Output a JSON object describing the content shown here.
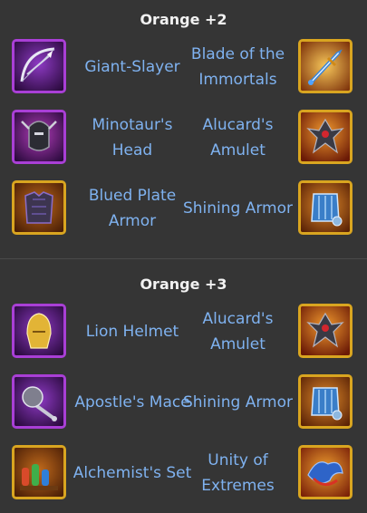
{
  "sections": [
    {
      "title": "Orange +2",
      "rows": [
        {
          "left": {
            "name": "Giant-Slayer",
            "icon": "bow-icon",
            "frame": "purple"
          },
          "right": {
            "name": "Blade of the Immortals",
            "icon": "glowing-sword-icon",
            "frame": "orange"
          }
        },
        {
          "left": {
            "name": "Minotaur's Head",
            "icon": "horned-helmet-icon",
            "frame": "purple"
          },
          "right": {
            "name": "Alucard's Amulet",
            "icon": "spiked-amulet-icon",
            "frame": "orange"
          }
        },
        {
          "left": {
            "name": "Blued Plate Armor",
            "icon": "plate-armor-icon",
            "frame": "orange"
          },
          "right": {
            "name": "Shining Armor",
            "icon": "blue-armor-icon",
            "frame": "orange"
          }
        }
      ]
    },
    {
      "title": "Orange +3",
      "rows": [
        {
          "left": {
            "name": "Lion Helmet",
            "icon": "lion-helmet-icon",
            "frame": "purple"
          },
          "right": {
            "name": "Alucard's Amulet",
            "icon": "spiked-amulet-icon",
            "frame": "orange"
          }
        },
        {
          "left": {
            "name": "Apostle's Mace",
            "icon": "mace-icon",
            "frame": "purple"
          },
          "right": {
            "name": "Shining Armor",
            "icon": "blue-armor-icon",
            "frame": "orange"
          }
        },
        {
          "left": {
            "name": "Alchemist's Set",
            "icon": "potion-set-icon",
            "frame": "orange"
          },
          "right": {
            "name": "Unity of Extremes",
            "icon": "dragon-emblem-icon",
            "frame": "orange"
          }
        }
      ]
    }
  ],
  "colors": {
    "background": "#353535",
    "title": "#f2f2f2",
    "item_name": "#7fb2f0",
    "purple_frame": "#a93fd6",
    "orange_frame": "#d9a520"
  }
}
